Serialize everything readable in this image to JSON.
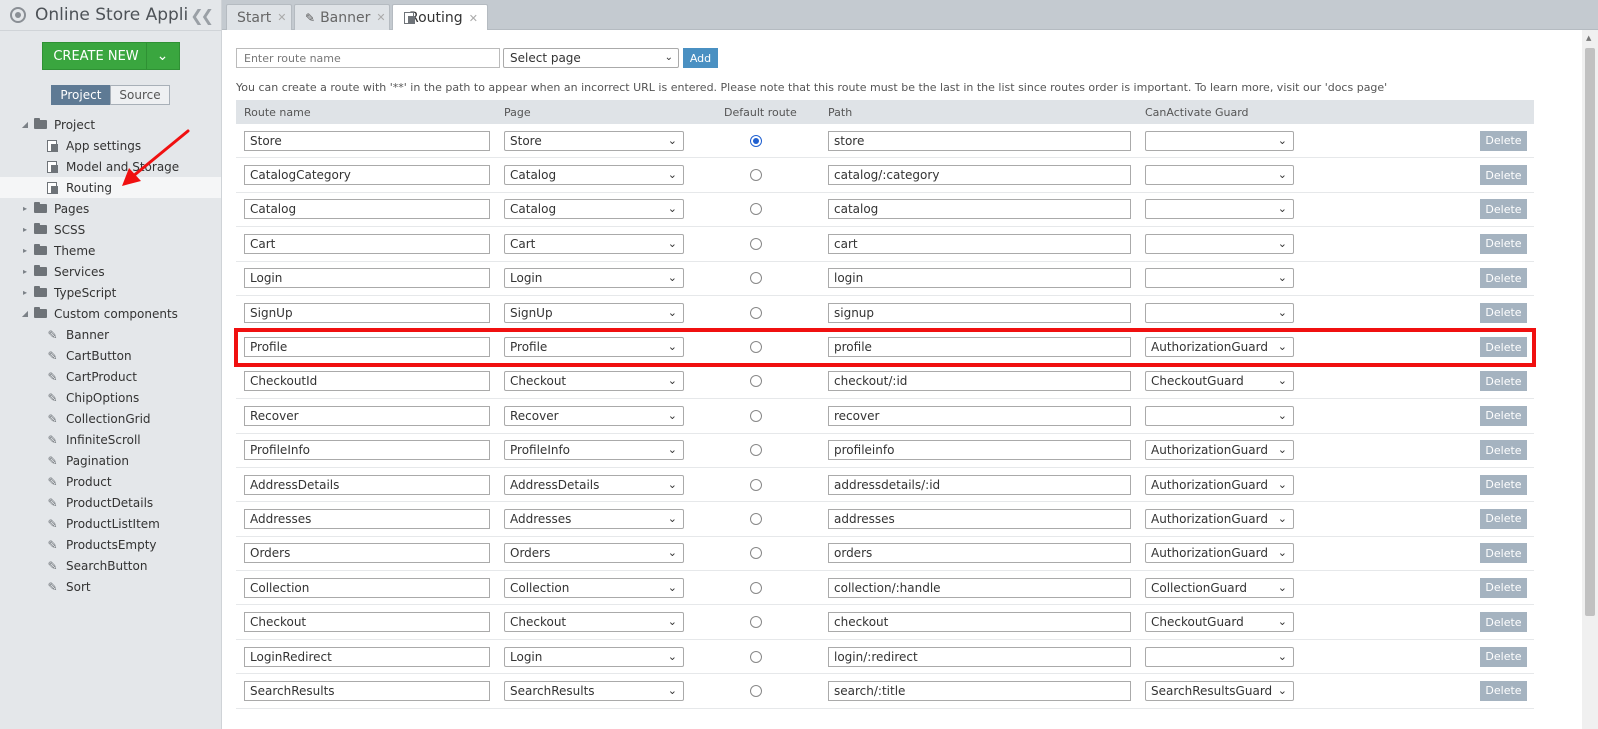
{
  "app": {
    "title": "Online Store Appli..."
  },
  "sidebar": {
    "create_label": "CREATE NEW",
    "view_toggle": {
      "project": "Project",
      "source": "Source"
    },
    "tree": [
      {
        "label": "Project",
        "type": "folder",
        "level": 0,
        "expanded": true
      },
      {
        "label": "App settings",
        "type": "file",
        "level": 1
      },
      {
        "label": "Model and Storage",
        "type": "file",
        "level": 1
      },
      {
        "label": "Routing",
        "type": "file",
        "level": 1,
        "selected": true
      },
      {
        "label": "Pages",
        "type": "folder",
        "level": 0
      },
      {
        "label": "SCSS",
        "type": "folder",
        "level": 0
      },
      {
        "label": "Theme",
        "type": "folder",
        "level": 0
      },
      {
        "label": "Services",
        "type": "folder",
        "level": 0
      },
      {
        "label": "TypeScript",
        "type": "folder",
        "level": 0
      },
      {
        "label": "Custom components",
        "type": "folder",
        "level": 0,
        "expanded": true
      },
      {
        "label": "Banner",
        "type": "component",
        "level": 1
      },
      {
        "label": "CartButton",
        "type": "component",
        "level": 1
      },
      {
        "label": "CartProduct",
        "type": "component",
        "level": 1
      },
      {
        "label": "ChipOptions",
        "type": "component",
        "level": 1
      },
      {
        "label": "CollectionGrid",
        "type": "component",
        "level": 1
      },
      {
        "label": "InfiniteScroll",
        "type": "component",
        "level": 1
      },
      {
        "label": "Pagination",
        "type": "component",
        "level": 1
      },
      {
        "label": "Product",
        "type": "component",
        "level": 1
      },
      {
        "label": "ProductDetails",
        "type": "component",
        "level": 1
      },
      {
        "label": "ProductListItem",
        "type": "component",
        "level": 1
      },
      {
        "label": "ProductsEmpty",
        "type": "component",
        "level": 1
      },
      {
        "label": "SearchButton",
        "type": "component",
        "level": 1
      },
      {
        "label": "Sort",
        "type": "component",
        "level": 1
      }
    ]
  },
  "tabs": [
    {
      "label": "Start",
      "icon": "",
      "active": false
    },
    {
      "label": "Banner",
      "icon": "pencil-icon",
      "active": false
    },
    {
      "label": "Routing",
      "icon": "file-icon",
      "active": true
    }
  ],
  "toolbar": {
    "route_placeholder": "Enter route name",
    "page_select": "Select page",
    "add_label": "Add"
  },
  "hint": "You can create a route with '**' in the path to appear when an incorrect URL is entered. Please note that this route must be the last in the list since routes order is important. To learn more, visit our 'docs page'",
  "table": {
    "headers": [
      "Route name",
      "Page",
      "Default route",
      "Path",
      "CanActivate Guard"
    ],
    "delete_label": "Delete",
    "highlight_row": 6,
    "rows": [
      {
        "name": "Store",
        "page": "Store",
        "default": true,
        "path": "store",
        "guard": ""
      },
      {
        "name": "CatalogCategory",
        "page": "Catalog",
        "default": false,
        "path": "catalog/:category",
        "guard": ""
      },
      {
        "name": "Catalog",
        "page": "Catalog",
        "default": false,
        "path": "catalog",
        "guard": ""
      },
      {
        "name": "Cart",
        "page": "Cart",
        "default": false,
        "path": "cart",
        "guard": ""
      },
      {
        "name": "Login",
        "page": "Login",
        "default": false,
        "path": "login",
        "guard": ""
      },
      {
        "name": "SignUp",
        "page": "SignUp",
        "default": false,
        "path": "signup",
        "guard": ""
      },
      {
        "name": "Profile",
        "page": "Profile",
        "default": false,
        "path": "profile",
        "guard": "AuthorizationGuard"
      },
      {
        "name": "CheckoutId",
        "page": "Checkout",
        "default": false,
        "path": "checkout/:id",
        "guard": "CheckoutGuard"
      },
      {
        "name": "Recover",
        "page": "Recover",
        "default": false,
        "path": "recover",
        "guard": ""
      },
      {
        "name": "ProfileInfo",
        "page": "ProfileInfo",
        "default": false,
        "path": "profileinfo",
        "guard": "AuthorizationGuard"
      },
      {
        "name": "AddressDetails",
        "page": "AddressDetails",
        "default": false,
        "path": "addressdetails/:id",
        "guard": "AuthorizationGuard"
      },
      {
        "name": "Addresses",
        "page": "Addresses",
        "default": false,
        "path": "addresses",
        "guard": "AuthorizationGuard"
      },
      {
        "name": "Orders",
        "page": "Orders",
        "default": false,
        "path": "orders",
        "guard": "AuthorizationGuard"
      },
      {
        "name": "Collection",
        "page": "Collection",
        "default": false,
        "path": "collection/:handle",
        "guard": "CollectionGuard"
      },
      {
        "name": "Checkout",
        "page": "Checkout",
        "default": false,
        "path": "checkout",
        "guard": "CheckoutGuard"
      },
      {
        "name": "LoginRedirect",
        "page": "Login",
        "default": false,
        "path": "login/:redirect",
        "guard": ""
      },
      {
        "name": "SearchResults",
        "page": "SearchResults",
        "default": false,
        "path": "search/:title",
        "guard": "SearchResultsGuard"
      }
    ]
  },
  "colors": {
    "accent_green": "#3aa63f",
    "highlight_red": "#f01010",
    "delete_button": "#a5b3c0",
    "add_button": "#4a90c2"
  }
}
